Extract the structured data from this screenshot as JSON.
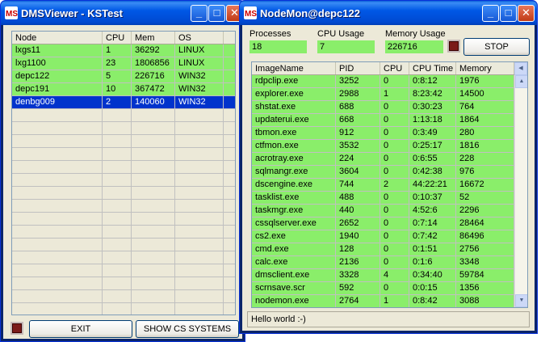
{
  "dms": {
    "title": "DMSViewer - KSTest",
    "columns": [
      "Node",
      "CPU",
      "Mem",
      "OS"
    ],
    "rows": [
      [
        "lxgs11",
        "1",
        "36292",
        "LINUX"
      ],
      [
        "lxg1100",
        "23",
        "1806856",
        "LINUX"
      ],
      [
        "depc122",
        "5",
        "226716",
        "WIN32"
      ],
      [
        "depc191",
        "10",
        "367472",
        "WIN32"
      ],
      [
        "denbg009",
        "2",
        "140060",
        "WIN32"
      ]
    ],
    "selected_row": 4,
    "exit_label": "EXIT",
    "show_label": "SHOW CS SYSTEMS"
  },
  "nodemon": {
    "title": "NodeMon@depc122",
    "processes_label": "Processes",
    "processes_value": "18",
    "cpu_label": "CPU Usage",
    "cpu_value": "7",
    "memory_label": "Memory Usage",
    "memory_value": "226716",
    "stop_label": "STOP",
    "columns": [
      "ImageName",
      "PID",
      "CPU",
      "CPU Time",
      "Memory"
    ],
    "rows": [
      [
        "rdpclip.exe",
        "3252",
        "0",
        "0:8:12",
        "1976"
      ],
      [
        "explorer.exe",
        "2988",
        "1",
        "8:23:42",
        "14500"
      ],
      [
        "shstat.exe",
        "688",
        "0",
        "0:30:23",
        "764"
      ],
      [
        "updaterui.exe",
        "668",
        "0",
        "1:13:18",
        "1864"
      ],
      [
        "tbmon.exe",
        "912",
        "0",
        "0:3:49",
        "280"
      ],
      [
        "ctfmon.exe",
        "3532",
        "0",
        "0:25:17",
        "1816"
      ],
      [
        "acrotray.exe",
        "224",
        "0",
        "0:6:55",
        "228"
      ],
      [
        "sqlmangr.exe",
        "3604",
        "0",
        "0:42:38",
        "976"
      ],
      [
        "dscengine.exe",
        "744",
        "2",
        "44:22:21",
        "16672"
      ],
      [
        "tasklist.exe",
        "488",
        "0",
        "0:10:37",
        "52"
      ],
      [
        "taskmgr.exe",
        "440",
        "0",
        "4:52:6",
        "2296"
      ],
      [
        "cssqlserver.exe",
        "2652",
        "0",
        "0:7:14",
        "28464"
      ],
      [
        "cs2.exe",
        "1940",
        "0",
        "0:7:42",
        "86496"
      ],
      [
        "cmd.exe",
        "128",
        "0",
        "0:1:51",
        "2756"
      ],
      [
        "calc.exe",
        "2136",
        "0",
        "0:1:6",
        "3348"
      ],
      [
        "dmsclient.exe",
        "3328",
        "4",
        "0:34:40",
        "59784"
      ],
      [
        "scrnsave.scr",
        "592",
        "0",
        "0:0:15",
        "1356"
      ],
      [
        "nodemon.exe",
        "2764",
        "1",
        "0:8:42",
        "3088"
      ]
    ],
    "status_text": "Hello world :-)"
  },
  "icons": {
    "app": "ms-app-icon",
    "minimize": "minimize-icon",
    "maximize": "maximize-icon",
    "close": "close-icon"
  },
  "colors": {
    "titlebar": "#0058e6",
    "row_green": "#8aee6a",
    "selection": "#0033cc",
    "window_bg": "#ece9d8"
  }
}
